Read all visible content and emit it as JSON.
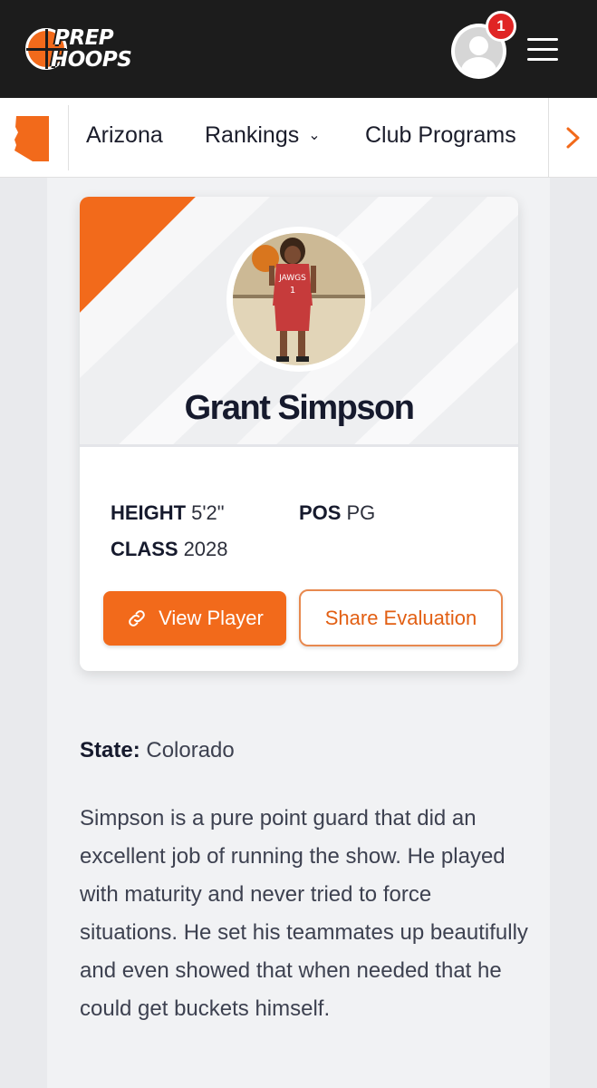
{
  "header": {
    "logo_line1": "PREP",
    "logo_line2": "HOOPS",
    "notification_count": "1"
  },
  "nav": {
    "state": "Arizona",
    "rankings": "Rankings",
    "club_programs": "Club Programs"
  },
  "player": {
    "name": "Grant Simpson",
    "jersey_text": "JAWGS",
    "jersey_number": "1",
    "height_label": "HEIGHT",
    "height_value": "5'2\"",
    "pos_label": "POS",
    "pos_value": "PG",
    "class_label": "CLASS",
    "class_value": "2028"
  },
  "buttons": {
    "view_player": "View Player",
    "share_evaluation": "Share Evaluation"
  },
  "article": {
    "state_label": "State:",
    "state_value": "Colorado",
    "evaluation": "Simpson is a pure point guard that did an excellent job of running the show. He played with maturity and never tried to force situations. He set his teammates up beautifully and even showed that when needed that he could get buckets himself."
  },
  "colors": {
    "brand_orange": "#f26a1b",
    "header_bg": "#1c1c1c",
    "badge_red": "#e02424"
  },
  "icons": [
    "basketball-logo-icon",
    "user-avatar-icon",
    "menu-icon",
    "arizona-state-icon",
    "chevron-down-icon",
    "chevron-right-icon",
    "link-icon"
  ]
}
